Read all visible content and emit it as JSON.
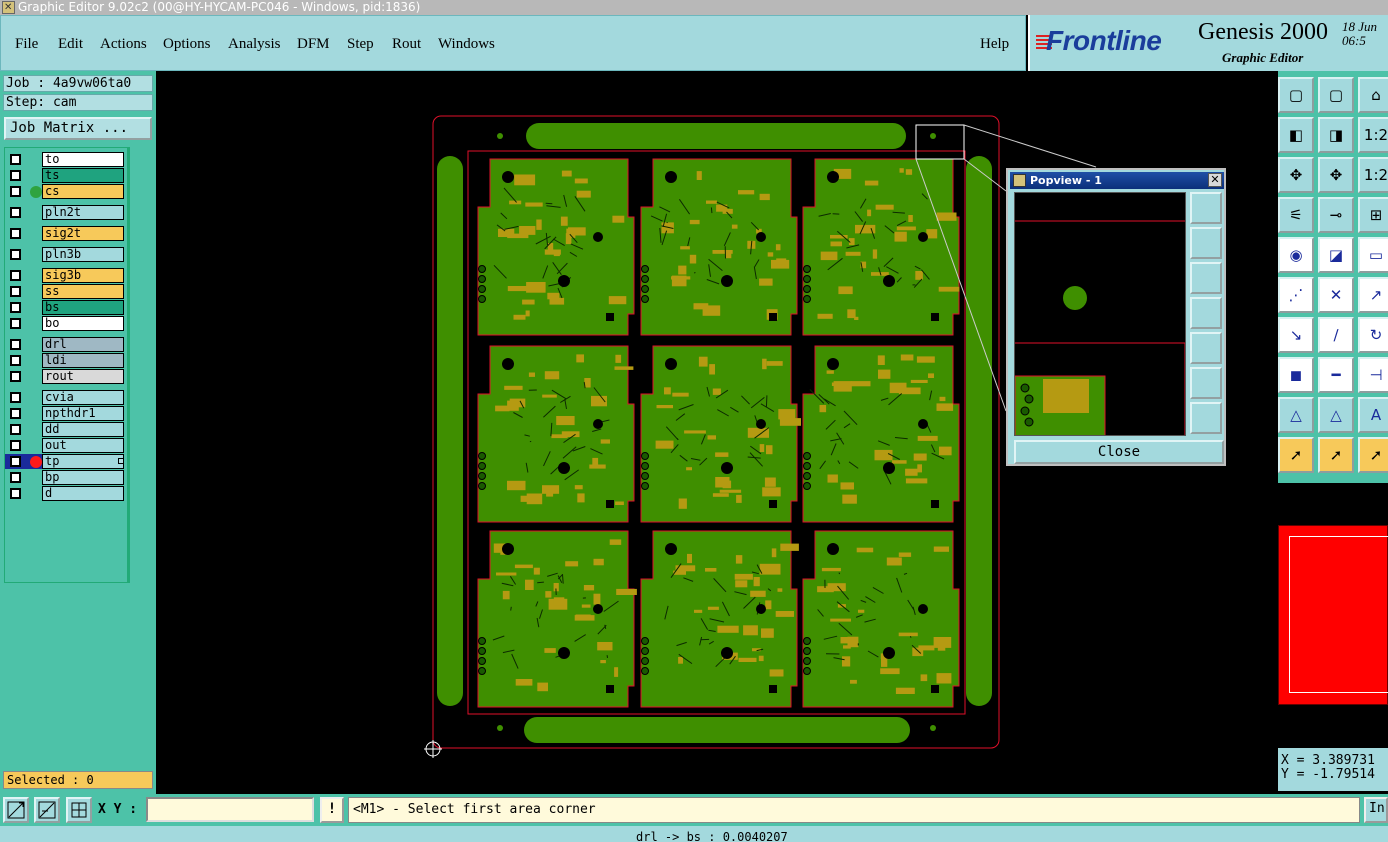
{
  "window": {
    "title": "Graphic Editor 9.02c2 (00@HY-HYCAM-PC046 - Windows, pid:1836)"
  },
  "menu": {
    "items": [
      "File",
      "Edit",
      "Actions",
      "Options",
      "Analysis",
      "DFM",
      "Step",
      "Rout",
      "Windows"
    ],
    "help": "Help"
  },
  "brand": {
    "logo": "Frontline",
    "product": "Genesis 2000",
    "subtitle": "Graphic Editor",
    "date_line1": "18 Jun",
    "date_line2": "06:5"
  },
  "job": {
    "job_label": "Job : 4a9vw06ta0",
    "step_label": "Step: cam",
    "matrix_button": "Job Matrix ..."
  },
  "layers": [
    {
      "name": "to",
      "color": "#ffffff",
      "dot": ""
    },
    {
      "name": "ts",
      "color": "#1fa37f",
      "dot": ""
    },
    {
      "name": "cs",
      "color": "#f7c95a",
      "dot": "#2fa340"
    },
    {
      "name": "pln2t",
      "color": "#a3d9dd",
      "dot": ""
    },
    {
      "name": "sig2t",
      "color": "#f7c95a",
      "dot": ""
    },
    {
      "name": "pln3b",
      "color": "#a3d9dd",
      "dot": ""
    },
    {
      "name": "sig3b",
      "color": "#f7c95a",
      "dot": ""
    },
    {
      "name": "ss",
      "color": "#f7c95a",
      "dot": ""
    },
    {
      "name": "bs",
      "color": "#1fa37f",
      "dot": ""
    },
    {
      "name": "bo",
      "color": "#ffffff",
      "dot": ""
    },
    {
      "name": "drl",
      "color": "#9fb8c4",
      "dot": ""
    },
    {
      "name": "ldi",
      "color": "#9fb8c4",
      "dot": ""
    },
    {
      "name": "rout",
      "color": "#d9d9d9",
      "dot": ""
    },
    {
      "name": "cvia",
      "color": "#a3d9dd",
      "dot": ""
    },
    {
      "name": "npthdr1",
      "color": "#a3d9dd",
      "dot": ""
    },
    {
      "name": "dd",
      "color": "#a3d9dd",
      "dot": ""
    },
    {
      "name": "out",
      "color": "#a3d9dd",
      "dot": ""
    },
    {
      "name": "tp",
      "color": "#a3d9dd",
      "dot": "#ff1a1a"
    },
    {
      "name": "bp",
      "color": "#a3d9dd",
      "dot": ""
    },
    {
      "name": "d",
      "color": "#a3d9dd",
      "dot": ""
    }
  ],
  "selected_label": "Selected : 0",
  "popview": {
    "title": "Popview - 1",
    "close_button": "Close"
  },
  "coords": {
    "x": "X = 3.389731",
    "y": "Y = -1.79514"
  },
  "bottom": {
    "xy_label": "X Y :",
    "xy_value": "",
    "warn_glyph": "!",
    "prompt": "<M1> - Select first area corner",
    "right_button": "In",
    "status": "drl -> bs : 0.0040207"
  },
  "colors": {
    "accent_teal": "#4dc2a8",
    "panel_light": "#a3d9dd",
    "board_green": "#3f8f00",
    "pad_gold": "#b59a12",
    "profile_red": "#e0102a"
  }
}
